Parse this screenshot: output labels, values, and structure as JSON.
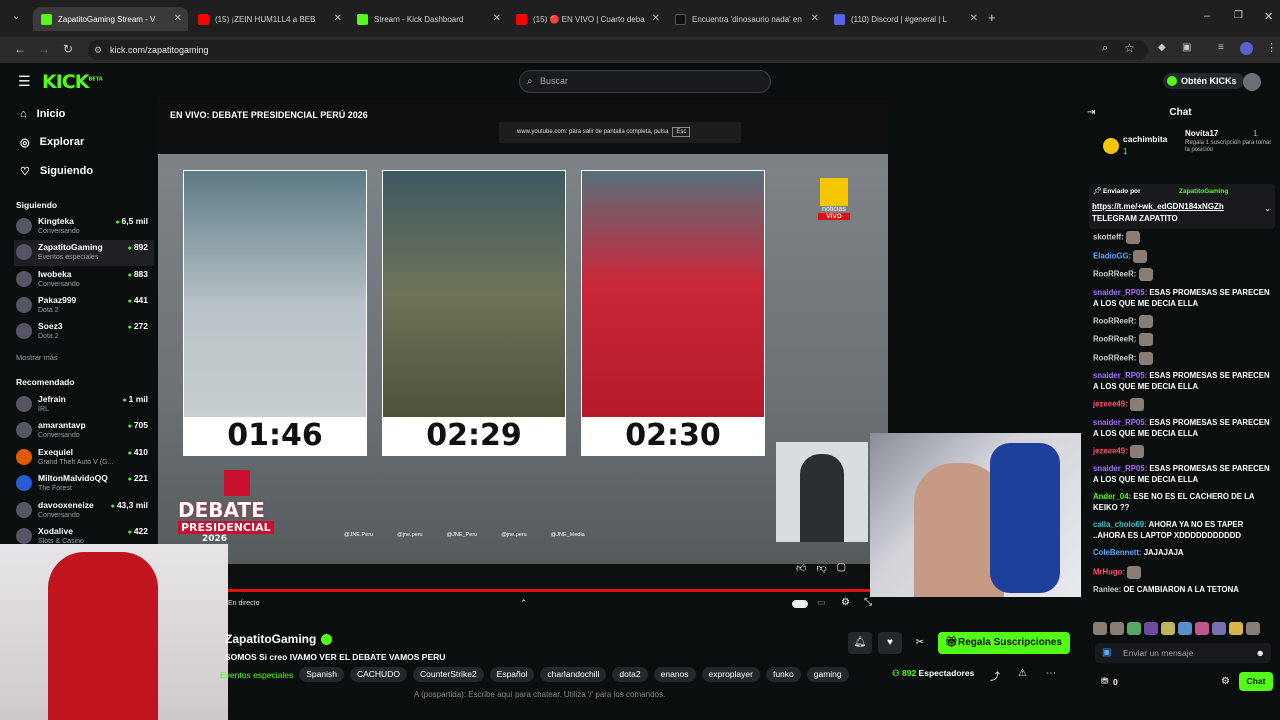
{
  "browser": {
    "tabs": [
      {
        "title": "ZapatitoGaming Stream - V",
        "icon_color": "#53fc18"
      },
      {
        "title": "(15) ¡ZEIN HUM1LL4 a BEB",
        "icon_color": "#ff0000"
      },
      {
        "title": "Stream - Kick Dashboard",
        "icon_color": "#53fc18"
      },
      {
        "title": "(15) 🔴 EN VIVO | Cuarto deba",
        "icon_color": "#ff0000"
      },
      {
        "title": "Encuentra 'dinosaurio nada' en",
        "icon_color": "#111111"
      },
      {
        "title": "(110) Discord | #general | L",
        "icon_color": "#5865f2"
      }
    ],
    "url": "kick.com/zapatitogaming"
  },
  "kick": {
    "logo": "KICK",
    "logo_sup": "BETA",
    "search_placeholder": "Buscar",
    "get_kicks": "Obtén KICKs"
  },
  "sidebar": {
    "nav": [
      {
        "label": "Inicio",
        "icon": "home-icon"
      },
      {
        "label": "Explorar",
        "icon": "compass-icon"
      },
      {
        "label": "Siguiendo",
        "icon": "heart-icon"
      }
    ],
    "following_header": "Siguiendo",
    "following": [
      {
        "name": "Kingteka",
        "sub": "Conversando",
        "viewers": "6,5 mil"
      },
      {
        "name": "ZapatitoGaming",
        "sub": "Eventos especiales",
        "viewers": "892"
      },
      {
        "name": "Iwobeka",
        "sub": "Conversando",
        "viewers": "883"
      },
      {
        "name": "Pakaz999",
        "sub": "Dota 2",
        "viewers": "441"
      },
      {
        "name": "Soez3",
        "sub": "Dota 2",
        "viewers": "272"
      }
    ],
    "show_more": "Mostrar más",
    "recommended_header": "Recomendado",
    "recommended": [
      {
        "name": "Jefrain",
        "sub": "IRL",
        "viewers": "1 mil"
      },
      {
        "name": "amarantavp",
        "sub": "Conversando",
        "viewers": "705"
      },
      {
        "name": "Exequiel",
        "sub": "Grand Theft Auto V (G...",
        "viewers": "410"
      },
      {
        "name": "MiltonMalvidoQQ",
        "sub": "The Forest",
        "viewers": "221"
      },
      {
        "name": "davooxeneize",
        "sub": "Conversando",
        "viewers": "43,3 mil"
      },
      {
        "name": "Xodalive",
        "sub": "Slots & Casino",
        "viewers": "422"
      }
    ]
  },
  "video": {
    "title": "EN VIVO: DEBATE PRESIDENCIAL PERÚ 2026",
    "fullscreen_msg": "www.youtube.com: para salir de pantalla completa, pulsa",
    "esc": "Esc",
    "timers": [
      "01:46",
      "02:29",
      "02:30"
    ],
    "channel_logo": "noticias",
    "channel_live": "VIVO",
    "debate_logo_line1": "DEBATE",
    "debate_logo_line2": "PRESIDENCIAL",
    "debate_logo_year": "2026",
    "socials": [
      "@JNE.Peru",
      "@jne.peru",
      "@JNE_Peru",
      "@jne.peru",
      "@JNE_Media"
    ],
    "live_label": "En directo"
  },
  "stream": {
    "streamer": "ZapatitoGaming",
    "title": "SOMOS Si creo IVAMO VER EL DEBATE VAMOS PERU",
    "category": "Eventos especiales",
    "tags": [
      "Spanish",
      "CACHUDO",
      "CounterStrike2",
      "Español",
      "charlandochill",
      "dota2",
      "enanos",
      "exproplayer",
      "funko",
      "gaming"
    ],
    "viewers": "892",
    "viewers_label": "Espectadores",
    "subscribe_label": "Regala Suscripciones",
    "chat_hint": "A (pospartida): Escribe aquí para chatear. Utiliza '/' para los comandos."
  },
  "chat": {
    "header": "Chat",
    "top_gifter": {
      "name": "cachimbita",
      "count": "1"
    },
    "gift_event": {
      "name": "Novita17",
      "count": "1",
      "text": "Regala 1 suscripción para tomar la posición"
    },
    "pinned": {
      "by_label": "Enviado por",
      "by": "ZapatitoGaming",
      "link": "https://t.me/+wk_edGDN184xNGZh",
      "text": "TELEGRAM ZAPATITO"
    },
    "messages": [
      {
        "user": "skotteff:",
        "color": "#cfcfcf",
        "text": "",
        "emote": true
      },
      {
        "user": "EladioGG:",
        "color": "#5aa9ff",
        "text": "",
        "emote": true
      },
      {
        "user": "RooRReeR:",
        "color": "#cfcfcf",
        "text": "",
        "emote": true
      },
      {
        "user": "snaider_RP05:",
        "color": "#a970ff",
        "text": "ESAS PROMESAS SE PARECEN A LOS QUE ME DECIA ELLA",
        "emote": false
      },
      {
        "user": "RooRReeR:",
        "color": "#cfcfcf",
        "text": "",
        "emote": true
      },
      {
        "user": "RooRReeR:",
        "color": "#cfcfcf",
        "text": "",
        "emote": true
      },
      {
        "user": "RooRReeR:",
        "color": "#cfcfcf",
        "text": "",
        "emote": true
      },
      {
        "user": "snaider_RP05:",
        "color": "#a970ff",
        "text": "ESAS PROMESAS SE PARECEN A LOS QUE ME DECIA ELLA",
        "emote": false
      },
      {
        "user": "jezeee49:",
        "color": "#ff4d6d",
        "text": "",
        "emote": true
      },
      {
        "user": "snaider_RP05:",
        "color": "#a970ff",
        "text": "ESAS PROMESAS SE PARECEN A LOS QUE ME DECIA ELLA",
        "emote": false
      },
      {
        "user": "jezeee49:",
        "color": "#ff4d6d",
        "text": "",
        "emote": true
      },
      {
        "user": "snaider_RP05:",
        "color": "#a970ff",
        "text": "ESAS PROMESAS SE PARECEN A LOS QUE ME DECIA ELLA",
        "emote": false
      },
      {
        "user": "Ander_04:",
        "color": "#53fc18",
        "text": "ESE NO ES EL CACHERO DE LA KEIKO ??",
        "emote": false
      },
      {
        "user": "calla_cholo69:",
        "color": "#40c4c4",
        "text": "AHORA YA NO ES TAPER ..AHORA ES LAPTOP XDDDDDDDDDDD",
        "emote": false
      },
      {
        "user": "ColeBennett:",
        "color": "#5aa9ff",
        "text": "JAJAJAJA",
        "emote": false
      },
      {
        "user": "MrHugo:",
        "color": "#ff4d6d",
        "text": "",
        "emote": true
      },
      {
        "user": "Ranlee:",
        "color": "#cfcfcf",
        "text": "OE CAMBIARON A LA TETONA",
        "emote": false
      }
    ],
    "input_placeholder": "Enviar un mensaje",
    "points": "0",
    "send_label": "Chat"
  }
}
